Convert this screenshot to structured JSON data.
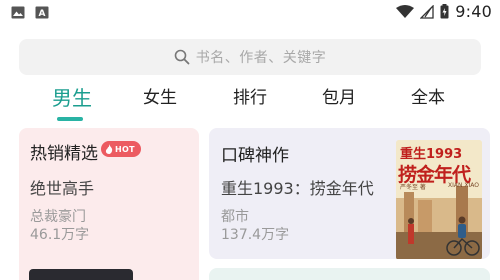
{
  "status_bar": {
    "left_icons": [
      "image-icon",
      "text-icon"
    ],
    "right_icons": [
      "wifi-icon",
      "signal-icon",
      "battery-icon"
    ],
    "time": "9:40"
  },
  "search": {
    "placeholder": "书名、作者、关键字"
  },
  "tabs": [
    {
      "label": "男生",
      "active": true
    },
    {
      "label": "女生",
      "active": false
    },
    {
      "label": "排行",
      "active": false
    },
    {
      "label": "包月",
      "active": false
    },
    {
      "label": "全本",
      "active": false
    }
  ],
  "accent_color": "#1b9e8f",
  "cards": {
    "hot_sellers": {
      "title": "热销精选",
      "badge": "HOT",
      "book_title": "绝世高手",
      "category": "总裁豪门",
      "word_count": "46.1万字"
    },
    "word_of_mouth": {
      "title": "口碑神作",
      "book_title": "重生1993：捞金年代",
      "category": "都市",
      "word_count": "137.4万字",
      "cover": {
        "top": "重生1993",
        "main": "捞金年代",
        "sub_left": "严冬至 著",
        "sub_right": "XIAN XIAO"
      }
    }
  }
}
